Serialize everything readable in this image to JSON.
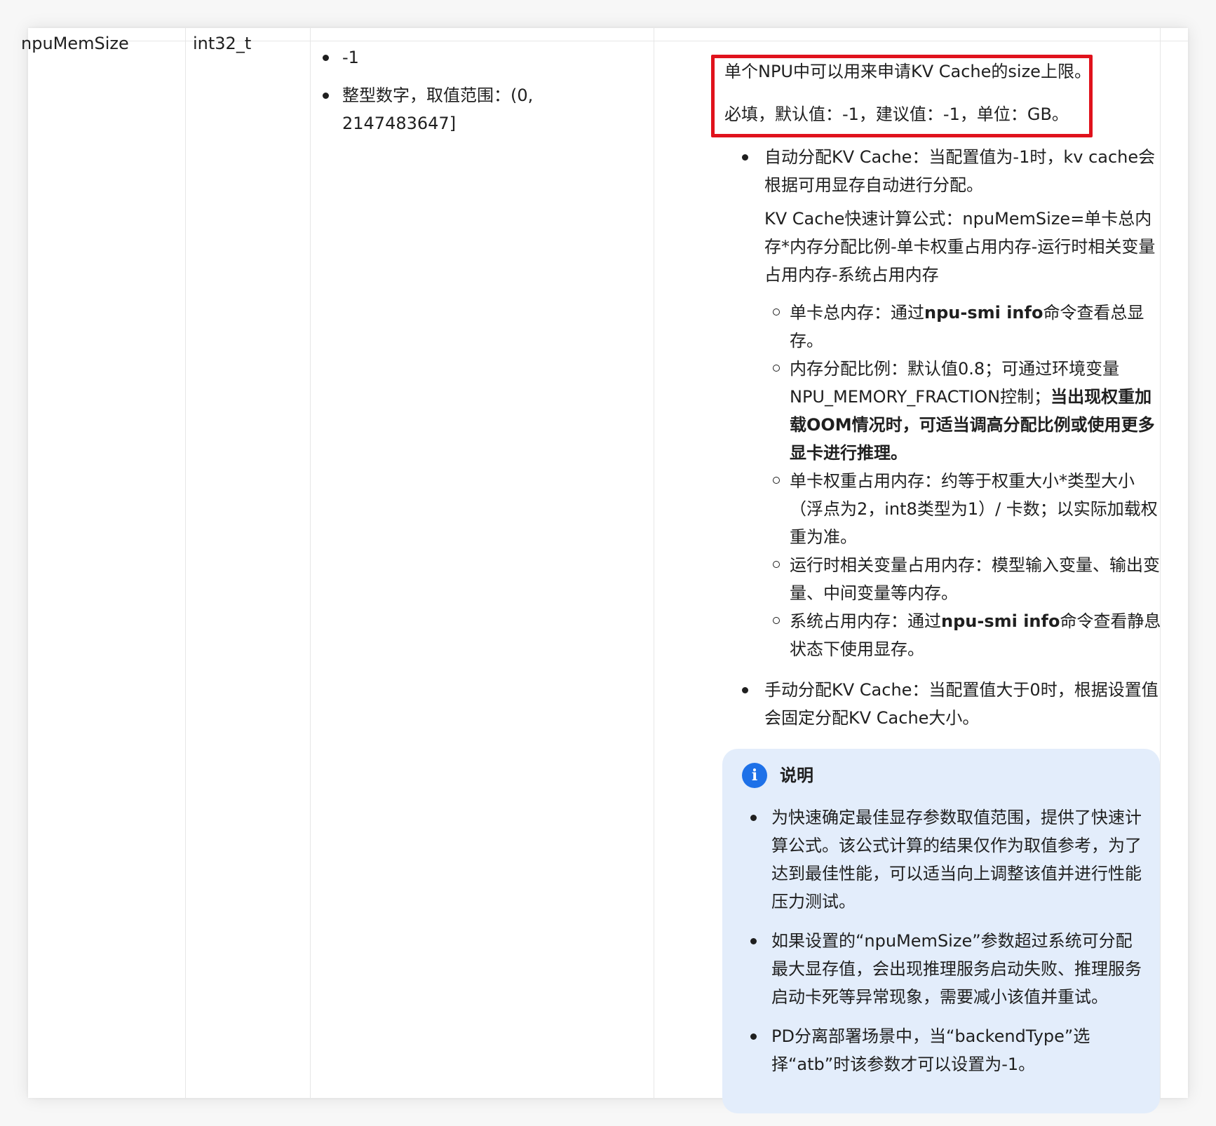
{
  "row": {
    "name": "npuMemSize",
    "type": "int32_t",
    "range": [
      "-1",
      "整型数字，取值范围：(0, 2147483647]"
    ],
    "description": {
      "summary": "单个NPU中可以用来申请KV Cache的size上限。",
      "required_line": "必填，默认值：-1，建议值：-1，单位：GB。",
      "auto": {
        "text": "自动分配KV Cache：当配置值为-1时，kv cache会根据可用显存自动进行分配。",
        "formula": "KV Cache快速计算公式：npuMemSize=单卡总内存*内存分配比例-单卡权重占用内存-运行时相关变量占用内存-系统占用内存",
        "items": [
          {
            "pre": "单卡总内存：通过",
            "bold": "npu-smi info",
            "post": "命令查看总显存。"
          },
          {
            "pre": "内存分配比例：默认值0.8；可通过环境变量NPU_MEMORY_FRACTION控制；",
            "bold": "当出现权重加载OOM情况时，可适当调高分配比例或使用更多显卡进行推理。",
            "post": ""
          },
          {
            "pre": "单卡权重占用内存：约等于权重大小*类型大小（浮点为2，int8类型为1）/ 卡数；以实际加载权重为准。",
            "bold": "",
            "post": ""
          },
          {
            "pre": "运行时相关变量占用内存：模型输入变量、输出变量、中间变量等内存。",
            "bold": "",
            "post": ""
          },
          {
            "pre": "系统占用内存：通过",
            "bold": "npu-smi info",
            "post": "命令查看静息状态下使用显存。"
          }
        ]
      },
      "manual": "手动分配KV Cache：当配置值大于0时，根据设置值会固定分配KV Cache大小。",
      "note": {
        "title": "说明",
        "icon": "info-icon",
        "items": [
          "为快速确定最佳显存参数取值范围，提供了快速计算公式。该公式计算的结果仅作为取值参考，为了达到最佳性能，可以适当向上调整该值并进行性能压力测试。",
          "如果设置的“npuMemSize”参数超过系统可分配最大显存值，会出现推理服务启动失败、推理服务启动卡死等异常现象，需要减小该值并重试。",
          "PD分离部署场景中，当“backendType”选择“atb”时该参数才可以设置为-1。"
        ]
      }
    }
  },
  "colors": {
    "highlight_border": "#e0121c",
    "note_background": "#e3edfb",
    "info_icon": "#1e71e8"
  }
}
